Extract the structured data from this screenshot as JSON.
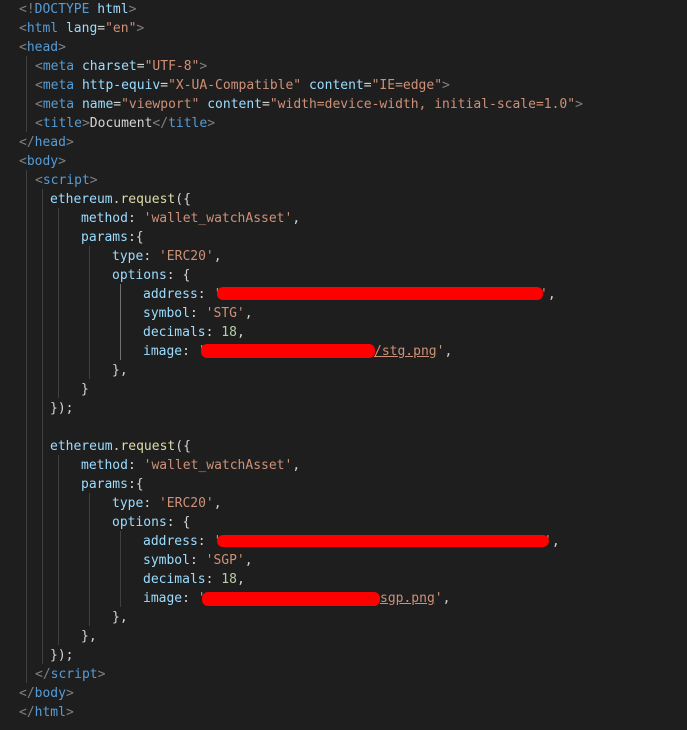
{
  "editor": {
    "doctype": {
      "open": "<!",
      "keyword": "DOCTYPE",
      "value": "html",
      "close": ">"
    },
    "html_open": {
      "tag": "html",
      "attr": "lang",
      "value": "\"en\""
    },
    "head_open": "head",
    "meta1": {
      "tag": "meta",
      "attr": "charset",
      "value": "\"UTF-8\""
    },
    "meta2": {
      "tag": "meta",
      "attr1": "http-equiv",
      "value1": "\"X-UA-Compatible\"",
      "attr2": "content",
      "value2": "\"IE=edge\""
    },
    "meta3": {
      "tag": "meta",
      "attr1": "name",
      "value1": "\"viewport\"",
      "attr2": "content",
      "value2": "\"width=device-width, initial-scale=1.0\""
    },
    "title": {
      "tag": "title",
      "text": "Document"
    },
    "head_close": "head",
    "body_open": "body",
    "script_open": "script",
    "req1": {
      "object": "ethereum",
      "method_name": "request",
      "method_key": "method",
      "method_value": "'wallet_watchAsset'",
      "params_key": "params",
      "type_key": "type",
      "type_value": "'ERC20'",
      "options_key": "options",
      "address_key": "address",
      "address_value_start": "'",
      "address_value_end": "'",
      "symbol_key": "symbol",
      "symbol_value": "'STG'",
      "decimals_key": "decimals",
      "decimals_value": "18",
      "image_key": "image",
      "image_value_start": "'",
      "image_value_end": "/stg.png",
      "image_quote": "'"
    },
    "req2": {
      "object": "ethereum",
      "method_name": "request",
      "method_key": "method",
      "method_value": "'wallet_watchAsset'",
      "params_key": "params",
      "type_key": "type",
      "type_value": "'ERC20'",
      "options_key": "options",
      "address_key": "address",
      "address_value_start": "'",
      "address_value_end": "'",
      "symbol_key": "symbol",
      "symbol_value": "'SGP'",
      "decimals_key": "decimals",
      "decimals_value": "18",
      "image_key": "image",
      "image_value_start": "'",
      "image_value_end": "sgp.png",
      "image_quote": "'"
    },
    "script_close": "script",
    "body_close": "body",
    "html_close": "html"
  },
  "colors": {
    "background": "#1e1e1e",
    "tag": "#569cd6",
    "attribute": "#9cdcfe",
    "string": "#ce9178",
    "function": "#dcdcaa",
    "number": "#b5cea8",
    "redaction": "#ff0000"
  }
}
